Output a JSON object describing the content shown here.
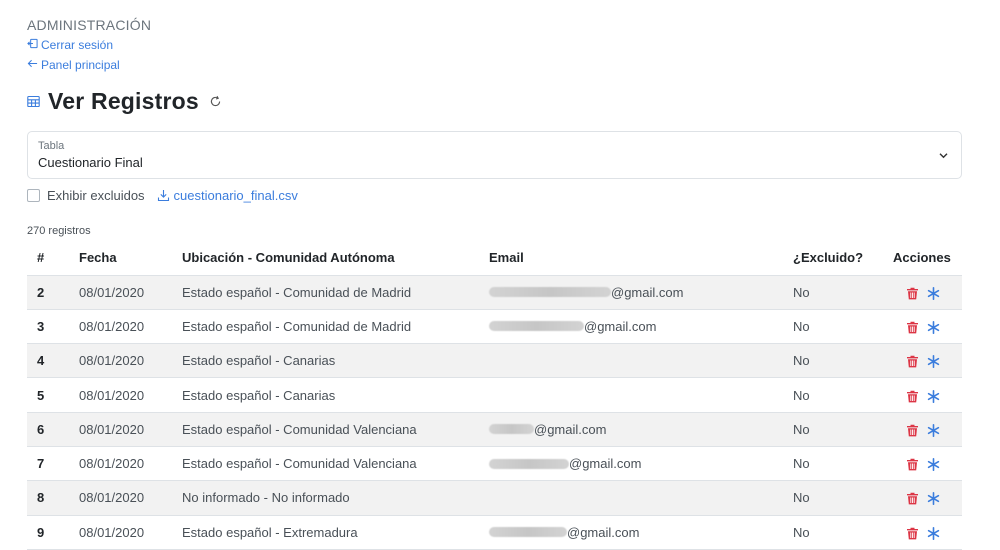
{
  "header": {
    "section": "ADMINISTRACIÓN",
    "logout": "Cerrar sesión",
    "dashboard": "Panel principal"
  },
  "page": {
    "title": "Ver Registros"
  },
  "table_select": {
    "label": "Tabla",
    "value": "Cuestionario Final"
  },
  "options": {
    "show_excluded_label": "Exhibir excluidos",
    "show_excluded_checked": false,
    "csv_link": "cuestionario_final.csv"
  },
  "records_count": "270 registros",
  "columns": [
    "#",
    "Fecha",
    "Ubicación - Comunidad Autónoma",
    "Email",
    "¿Excluido?",
    "Acciones"
  ],
  "rows": [
    {
      "num": "2",
      "date": "08/01/2020",
      "location": "Estado español - Comunidad de Madrid",
      "email_suffix": "@gmail.com",
      "excluded": "No"
    },
    {
      "num": "3",
      "date": "08/01/2020",
      "location": "Estado español - Comunidad de Madrid",
      "email_suffix": "@gmail.com",
      "excluded": "No"
    },
    {
      "num": "4",
      "date": "08/01/2020",
      "location": "Estado español - Canarias",
      "email_suffix": "",
      "excluded": "No"
    },
    {
      "num": "5",
      "date": "08/01/2020",
      "location": "Estado español - Canarias",
      "email_suffix": "",
      "excluded": "No"
    },
    {
      "num": "6",
      "date": "08/01/2020",
      "location": "Estado español - Comunidad Valenciana",
      "email_suffix": "@gmail.com",
      "excluded": "No"
    },
    {
      "num": "7",
      "date": "08/01/2020",
      "location": "Estado español - Comunidad Valenciana",
      "email_suffix": "@gmail.com",
      "excluded": "No"
    },
    {
      "num": "8",
      "date": "08/01/2020",
      "location": "No informado - No informado",
      "email_suffix": "",
      "excluded": "No"
    },
    {
      "num": "9",
      "date": "08/01/2020",
      "location": "Estado español - Extremadura",
      "email_suffix": "@gmail.com",
      "excluded": "No"
    }
  ],
  "icons": {
    "logout": "logout-icon",
    "back": "arrow-left-icon",
    "table": "table-icon",
    "refresh": "refresh-icon",
    "chevron": "chevron-down-icon",
    "download": "download-icon",
    "delete": "trash-icon",
    "exclude": "asterisk-icon"
  },
  "colors": {
    "link": "#3b7ddd",
    "delete": "#dc3545",
    "exclude": "#3b7ddd",
    "row_stripe": "#f2f2f2"
  }
}
